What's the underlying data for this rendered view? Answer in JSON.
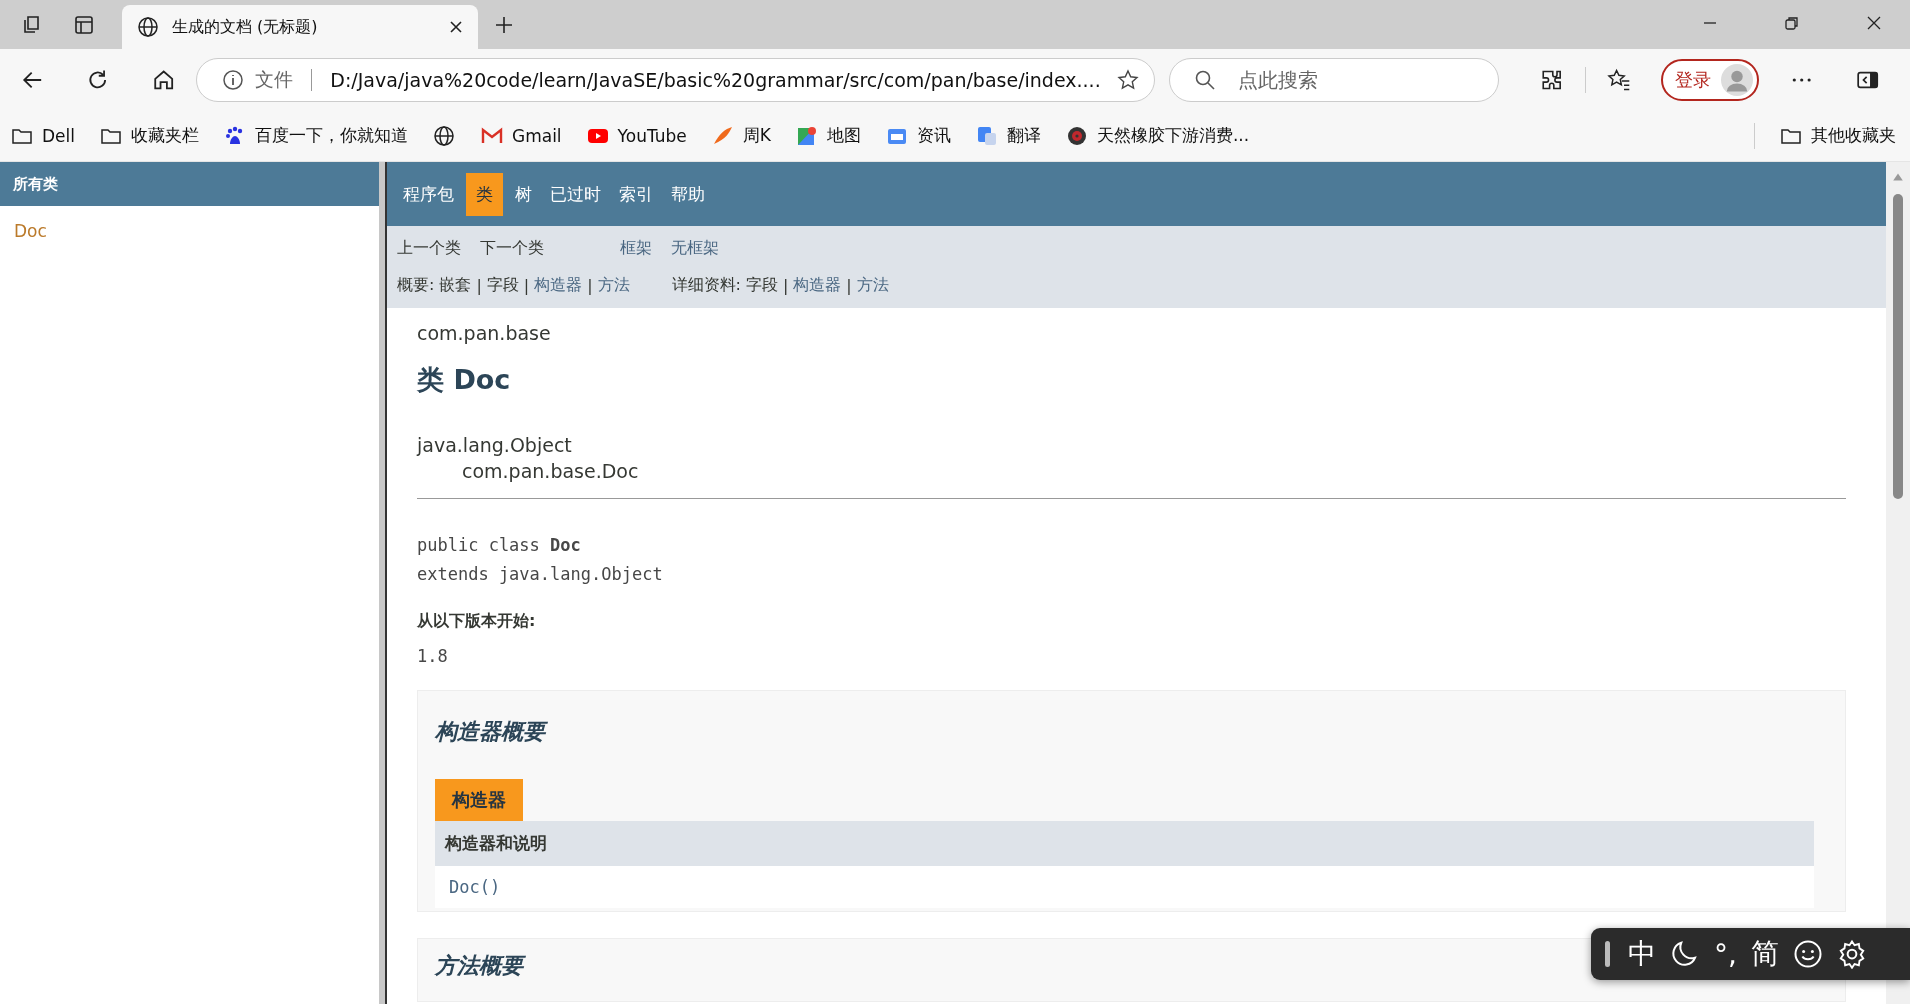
{
  "browser": {
    "tabs": [
      {
        "title": "生成的文档 (无标题)",
        "selected": true
      }
    ],
    "address": {
      "scheme_label": "文件",
      "url": "D:/Java/java%20code/learn/JavaSE/basic%20grammar/src/com/pan/base/index...."
    },
    "search": {
      "placeholder": "点此搜索"
    },
    "sign_in": "登录",
    "bookmarks": [
      {
        "kind": "folder",
        "label": "Dell"
      },
      {
        "kind": "folder",
        "label": "收藏夹栏"
      },
      {
        "kind": "paw",
        "label": "百度一下，你就知道"
      },
      {
        "kind": "globe"
      },
      {
        "kind": "mail",
        "label": "Gmail"
      },
      {
        "kind": "play",
        "label": "YouTube"
      },
      {
        "kind": "bird",
        "label": "周K"
      },
      {
        "kind": "map",
        "label": "地图"
      },
      {
        "kind": "news",
        "label": "资讯"
      },
      {
        "kind": "translate",
        "label": "翻译"
      },
      {
        "kind": "wheel",
        "label": "天然橡胶下游消费..."
      }
    ],
    "other_bookmarks": "其他收藏夹"
  },
  "left_frame": {
    "title": "所有类",
    "classes": [
      "Doc"
    ]
  },
  "nav": [
    {
      "label": "程序包",
      "selected": false
    },
    {
      "label": "类",
      "selected": true
    },
    {
      "label": "树",
      "selected": false
    },
    {
      "label": "已过时",
      "selected": false
    },
    {
      "label": "索引",
      "selected": false
    },
    {
      "label": "帮助",
      "selected": false
    }
  ],
  "subnav": {
    "class_links": [
      {
        "label": "上一个类",
        "link": false
      },
      {
        "label": "下一个类",
        "link": false
      }
    ],
    "frame_links": [
      {
        "label": "框架",
        "link": true
      },
      {
        "label": "无框架",
        "link": true
      }
    ],
    "summary": {
      "label": "概要:",
      "separator": "|",
      "items": [
        {
          "label": "嵌套",
          "link": false
        },
        {
          "label": "字段",
          "link": false
        },
        {
          "label": "构造器",
          "link": true
        },
        {
          "label": "方法",
          "link": true
        }
      ]
    },
    "detail": {
      "label": "详细资料:",
      "separator": "|",
      "items": [
        {
          "label": "字段",
          "link": false
        },
        {
          "label": "构造器",
          "link": true
        },
        {
          "label": "方法",
          "link": true
        }
      ]
    }
  },
  "content": {
    "package": "com.pan.base",
    "title": "类 Doc",
    "inheritance": [
      "java.lang.Object",
      "com.pan.base.Doc"
    ],
    "signature": [
      "public class **Doc**",
      "extends java.lang.Object"
    ],
    "since_label": "从以下版本开始:",
    "since": "1.8",
    "constructor_summary": {
      "heading": "构造器概要",
      "tab": "构造器",
      "column": "构造器和说明",
      "rows": [
        "Doc()"
      ]
    },
    "method_summary": {
      "heading": "方法概要"
    }
  },
  "ime": {
    "items": [
      {
        "kind": "text",
        "label": "中"
      },
      {
        "kind": "moon"
      },
      {
        "kind": "text",
        "label": "°,"
      },
      {
        "kind": "text",
        "label": "简"
      },
      {
        "kind": "smiley"
      },
      {
        "kind": "gear"
      }
    ]
  }
}
